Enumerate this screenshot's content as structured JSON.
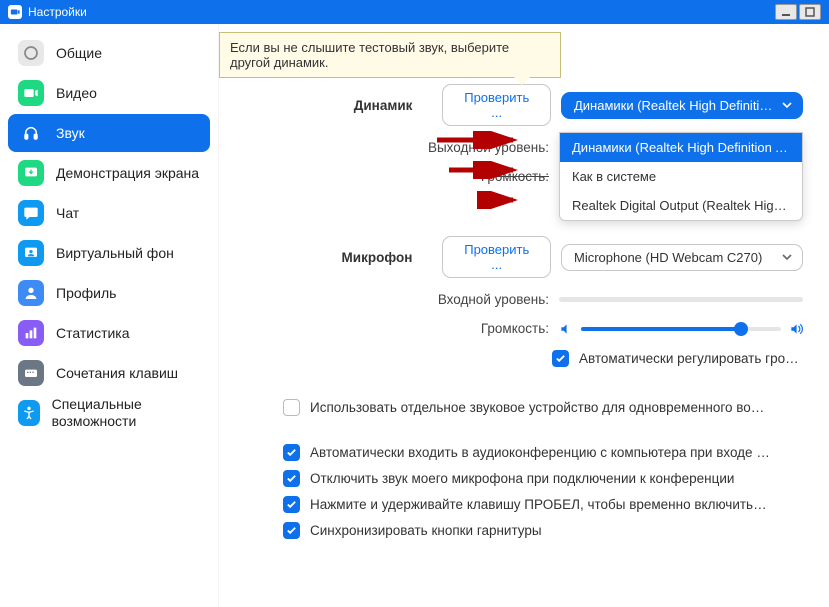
{
  "titlebar": {
    "title": "Настройки"
  },
  "sidebar": {
    "items": [
      {
        "label": "Общие"
      },
      {
        "label": "Видео"
      },
      {
        "label": "Звук"
      },
      {
        "label": "Демонстрация экрана"
      },
      {
        "label": "Чат"
      },
      {
        "label": "Виртуальный фон"
      },
      {
        "label": "Профиль"
      },
      {
        "label": "Статистика"
      },
      {
        "label": "Сочетания клавиш"
      },
      {
        "label": "Специальные возможности"
      }
    ]
  },
  "tooltip": "Если вы не слышите тестовый звук, выберите другой динамик.",
  "speaker": {
    "label": "Динамик",
    "test_btn": "Проверить ...",
    "selected": "Динамики (Realtek High Definitio...",
    "output_level_label": "Выходной уровень:",
    "volume_label": "Громкость:",
    "options": [
      "Динамики (Realtek High Definition Au...",
      "Как в системе",
      "Realtek Digital Output (Realtek High D..."
    ]
  },
  "microphone": {
    "label": "Микрофон",
    "test_btn": "Проверить ...",
    "selected": "Microphone (HD Webcam C270)",
    "input_level_label": "Входной уровень:",
    "volume_label": "Громкость:",
    "auto_adjust": "Автоматически регулировать гром..."
  },
  "options": {
    "separate_device": "Использовать отдельное звуковое устройство для одновременного воспро...",
    "auto_join_audio": "Автоматически входить в аудиоконференцию с компьютера при входе в кон...",
    "mute_on_join": "Отключить звук моего микрофона при подключении к конференции",
    "space_unmute": "Нажмите и удерживайте клавишу ПРОБЕЛ, чтобы временно включить свой з...",
    "sync_headset": "Синхронизировать кнопки гарнитуры"
  }
}
